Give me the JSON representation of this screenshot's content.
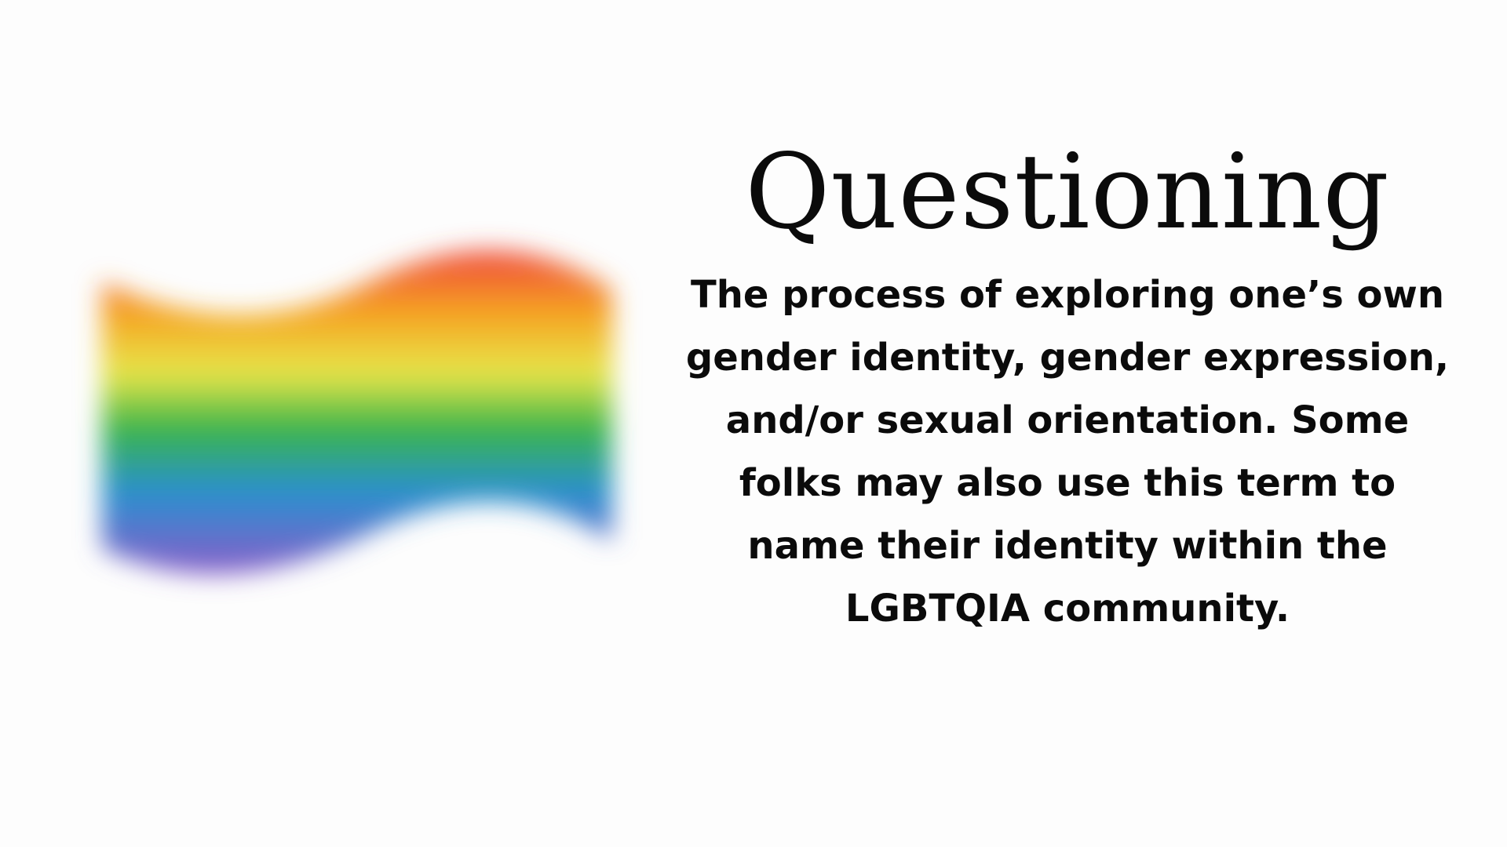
{
  "slide": {
    "title": "Questioning",
    "definition": "The process of exploring one’s own gender identity, gender expression, and/or sexual orientation. Some folks may also use this term to name their identity within the LGBTQIA community."
  },
  "flag": {
    "icon": "rainbow-flag-icon",
    "colors": [
      "#f0453a",
      "#f5a623",
      "#e7e64a",
      "#39b54a",
      "#2a8fd0",
      "#8a5cc8"
    ]
  },
  "colors": {
    "background": "#fdfdfd",
    "text": "#0b0b0b"
  }
}
